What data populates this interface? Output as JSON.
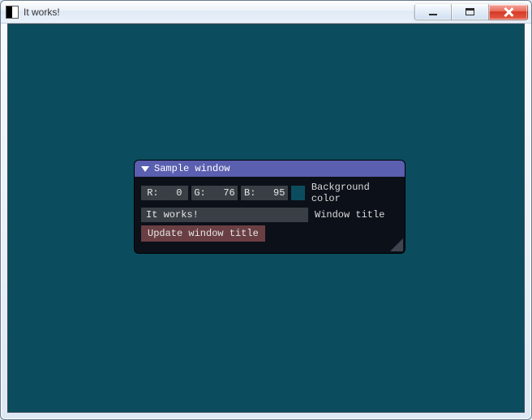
{
  "window": {
    "title": "It works!"
  },
  "client": {
    "background_hex": "#0b4d5e"
  },
  "panel": {
    "title": "Sample window",
    "color_row": {
      "r_label": "R:",
      "r_value": "0",
      "g_label": "G:",
      "g_value": "76",
      "b_label": "B:",
      "b_value": "95",
      "swatch_hex": "#0b4d5e",
      "caption": "Background color"
    },
    "title_row": {
      "value": "It works!",
      "caption": "Window title"
    },
    "update_button": "Update window title"
  }
}
